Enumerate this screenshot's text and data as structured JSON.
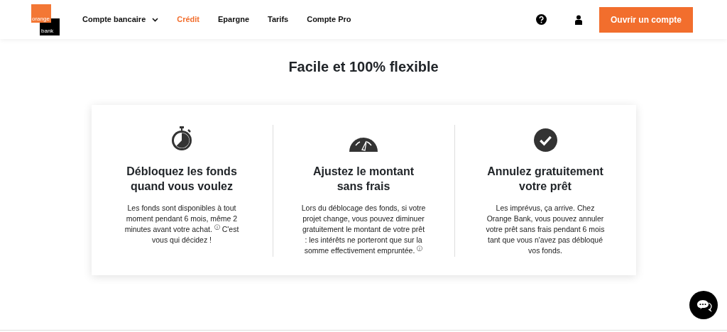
{
  "logo": {
    "line_1": "orange",
    "line_2": "bank"
  },
  "nav": [
    {
      "label": "Compte bancaire",
      "selected": false,
      "dropdown": true
    },
    {
      "label": "Crédit",
      "selected": true,
      "dropdown": false
    },
    {
      "label": "Epargne",
      "selected": false,
      "dropdown": false
    },
    {
      "label": "Tarifs",
      "selected": false,
      "dropdown": false
    },
    {
      "label": "Compte Pro",
      "selected": false,
      "dropdown": false
    }
  ],
  "cta": "Ouvrir un compte",
  "heading": "Facile et 100% flexible",
  "features": [
    {
      "kind": "stopwatch",
      "title": "Débloquez les fonds quand vous voulez",
      "text": "Les fonds sont disponibles à tout moment pendant 6 mois, même 2 minutes avant votre achat. $^{ⓘ}$  C'est vous qui décidez !"
    },
    {
      "kind": "gauge",
      "title": "Ajustez le montant sans frais",
      "text": "Lors du déblocage des fonds, si votre projet change, vous pouvez diminuer gratuitement le montant de votre prêt : les intérêts ne porteront que sur la somme effectivement empruntée. $^{ⓘ}$"
    },
    {
      "kind": "check",
      "title": "Annulez gratuitement votre prêt",
      "text": "Les imprévus, ça arrive. Chez Orange Bank, vous pouvez annuler votre prêt sans frais pendant 6 mois tant que vous n'avez pas débloqué vos fonds."
    }
  ]
}
